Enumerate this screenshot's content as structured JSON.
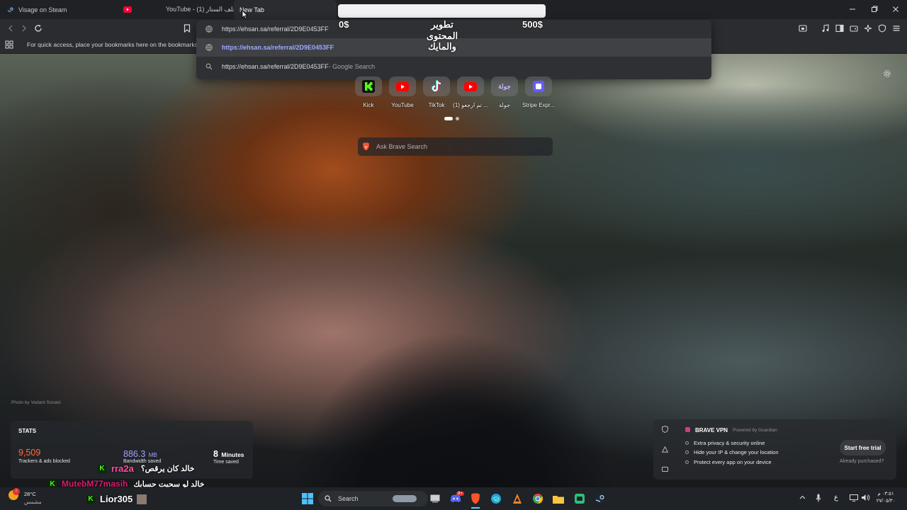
{
  "browser": {
    "tabs": [
      {
        "title": "Visage on Steam"
      },
      {
        "title": "YouTube - خلف الستار (1)"
      },
      {
        "title": "New Tab"
      }
    ],
    "window_controls": {
      "minimize": "─",
      "maximize": "▢",
      "close": "✕"
    }
  },
  "omnibox": {
    "value": "https://ehsan.sa/referral/2D9E0453FF",
    "suggestions": [
      {
        "text": "https://ehsan.sa/referral/2D9E0453FF",
        "suffix": ""
      },
      {
        "text": "https://ehsan.sa/referral/2D9E0453FF",
        "suffix": " - Google Search"
      }
    ]
  },
  "bookmarks_bar": {
    "hint": "For quick access, place your bookmarks here on the bookmarks bar."
  },
  "stream_overlay": {
    "left_amount": "0$",
    "goal_line1": "تطوير",
    "goal_line2": "المحتوى",
    "goal_line3": "والمايك",
    "right_amount": "500$"
  },
  "top_sites": [
    {
      "label": "Kick",
      "icon": "kick-icon",
      "color": "#53fc18"
    },
    {
      "label": "YouTube",
      "icon": "youtube-icon",
      "color": "#ff0000"
    },
    {
      "label": "TikTok",
      "icon": "tiktok-icon",
      "color": "#ffffff"
    },
    {
      "label": "(1) تم ارجعو ...",
      "icon": "youtube-icon",
      "color": "#ff0000"
    },
    {
      "label": "جولة",
      "icon": "jawla-icon",
      "glyph": "جولة",
      "color": "#b89bff"
    },
    {
      "label": "Stripe Expr...",
      "icon": "stripe-icon",
      "color": "#635bff"
    }
  ],
  "search": {
    "placeholder": "Ask Brave Search"
  },
  "photo_credit": "Photo by Vedant Sonani",
  "stats": {
    "title": "STATS",
    "trackers": {
      "value": "9,509",
      "label": "Trackers & ads blocked",
      "color": "#ff6b42"
    },
    "bandwidth": {
      "value": "886.3",
      "unit": "MB",
      "label": "Bandwidth saved",
      "color": "#a3a0ff"
    },
    "time": {
      "value": "8",
      "unit": "Minutes",
      "label": "Time saved",
      "color": "#ffffff"
    }
  },
  "chat": [
    {
      "user": "rra2a",
      "message": "خالد كان يرقص؟",
      "user_color": "#ff4fa3"
    },
    {
      "user": "MutebM77masih",
      "message": "خالد لو سحبت حسابك",
      "user_color": "#d61b6f"
    },
    {
      "user": "Lior305",
      "message": "",
      "user_color": "#ffffff"
    }
  ],
  "vpn": {
    "title": "BRAVE VPN",
    "powered": "Powered by Guardian",
    "features": [
      "Extra privacy & security online",
      "Hide your IP & change your location",
      "Protect every app on your device"
    ],
    "cta": "Start free trial",
    "already": "Already purchased?"
  },
  "taskbar": {
    "weather_temp": "28°C",
    "weather_desc": "مشمس",
    "search_label": "Search",
    "discord_badge": "9+",
    "input_lang": "ع",
    "time": "٠٣:٥١ م",
    "date": "٢٧/٠٥/٣٠"
  }
}
